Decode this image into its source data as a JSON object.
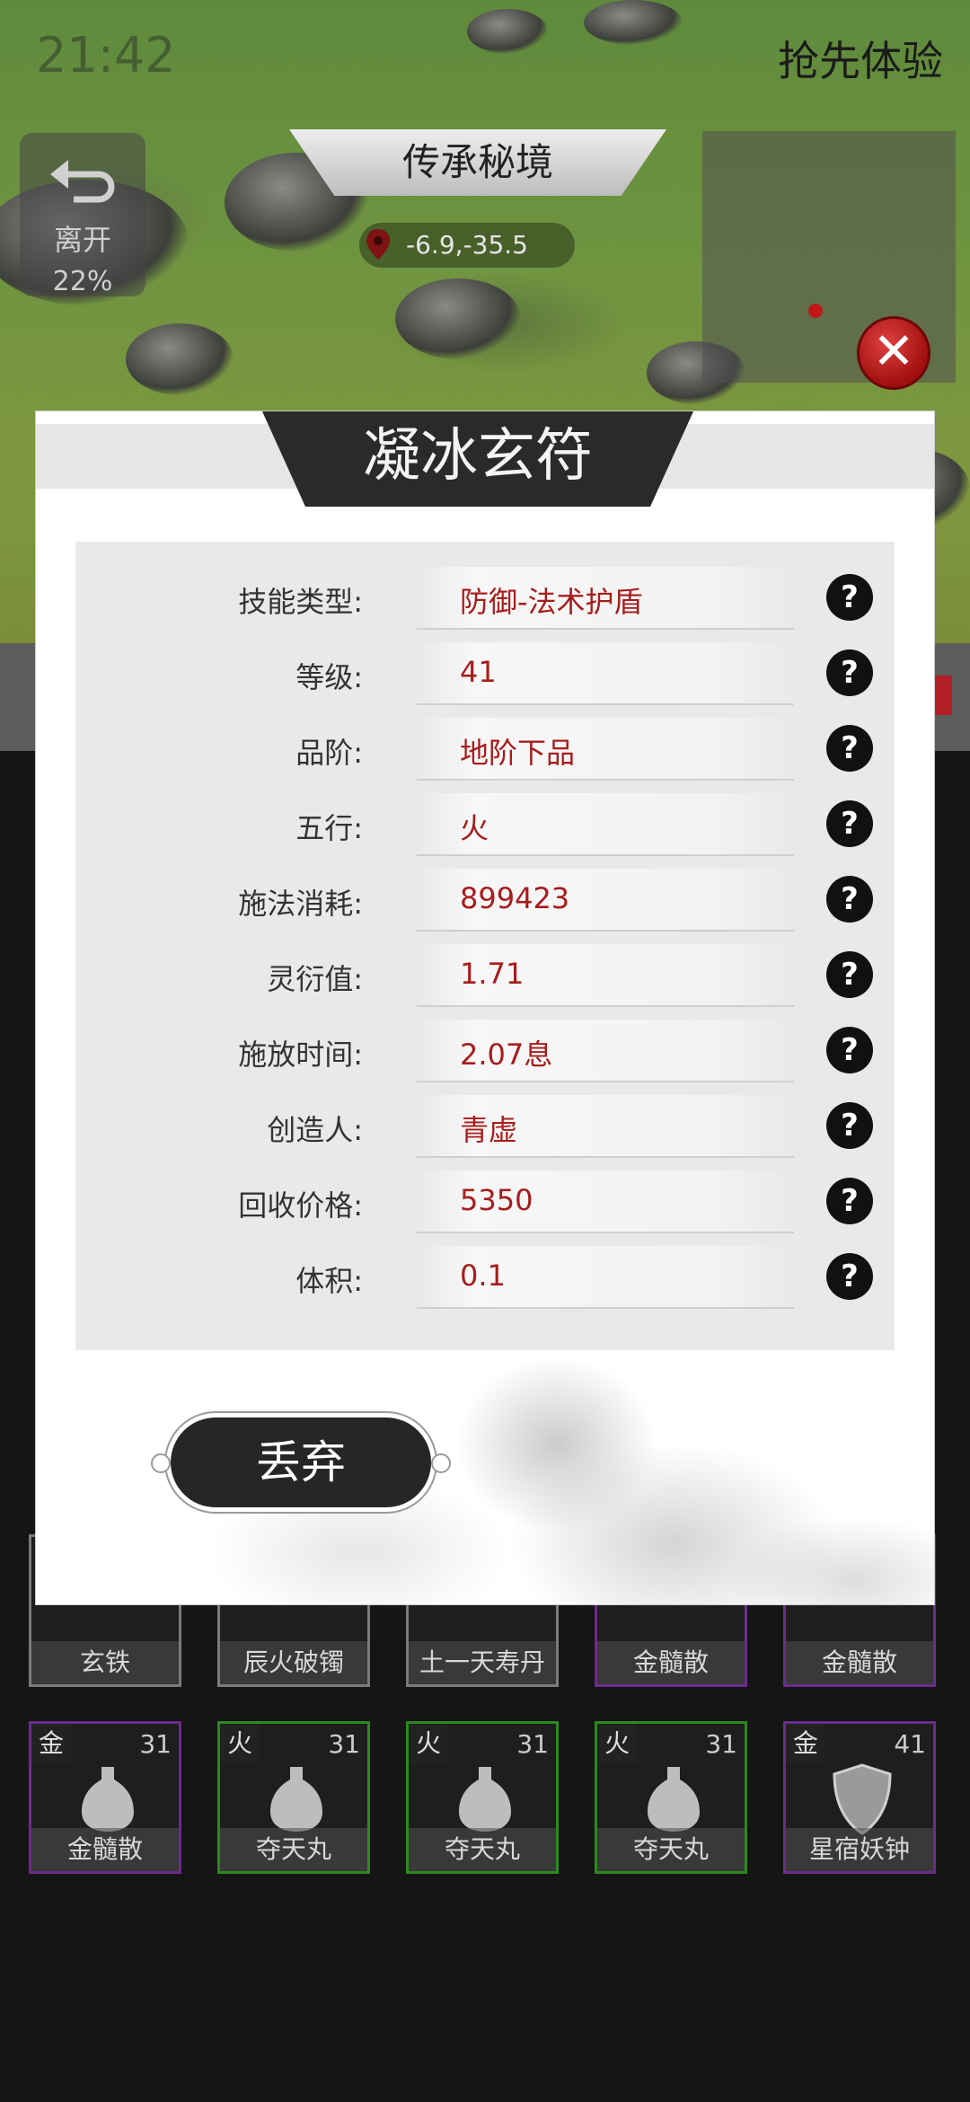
{
  "status": {
    "time": "21:42",
    "early_access": "抢先体验"
  },
  "leave": {
    "label": "离开",
    "percent": "22%"
  },
  "location": {
    "name": "传承秘境",
    "coords": "-6.9,-35.5"
  },
  "modal": {
    "title": "凝冰玄符",
    "rows": [
      {
        "label": "技能类型:",
        "value": "防御-法术护盾"
      },
      {
        "label": "等级:",
        "value": "41"
      },
      {
        "label": "品阶:",
        "value": "地阶下品"
      },
      {
        "label": "五行:",
        "value": "火"
      },
      {
        "label": "施法消耗:",
        "value": "899423"
      },
      {
        "label": "灵衍值:",
        "value": "1.71"
      },
      {
        "label": "施放时间:",
        "value": "2.07息"
      },
      {
        "label": "创造人:",
        "value": "青虚"
      },
      {
        "label": "回收价格:",
        "value": "5350"
      },
      {
        "label": "体积:",
        "value": "0.1"
      }
    ],
    "help_symbol": "?",
    "discard_label": "丢弃"
  },
  "inventory": {
    "row1": [
      {
        "name": "玄铁",
        "quality": "gray"
      },
      {
        "name": "辰火破镯",
        "quality": "gray"
      },
      {
        "name": "土一天寿丹",
        "quality": "gray"
      },
      {
        "name": "金髓散",
        "quality": "purple"
      },
      {
        "name": "金髓散",
        "quality": "purple"
      }
    ],
    "row2": [
      {
        "element": "金",
        "level": "31",
        "name": "金髓散",
        "quality": "purple",
        "icon": "vase-icon"
      },
      {
        "element": "火",
        "level": "31",
        "name": "夺天丸",
        "quality": "green",
        "icon": "vase-icon"
      },
      {
        "element": "火",
        "level": "31",
        "name": "夺天丸",
        "quality": "green",
        "icon": "vase-icon"
      },
      {
        "element": "火",
        "level": "31",
        "name": "夺天丸",
        "quality": "green",
        "icon": "vase-icon"
      },
      {
        "element": "金",
        "level": "41",
        "name": "星宿妖钟",
        "quality": "purple",
        "icon": "shield-icon"
      }
    ]
  },
  "colors": {
    "value_text": "#a81c1c",
    "purple_border": "#6d2a8f",
    "green_border": "#2b8a1d",
    "close_red": "#c01818"
  }
}
